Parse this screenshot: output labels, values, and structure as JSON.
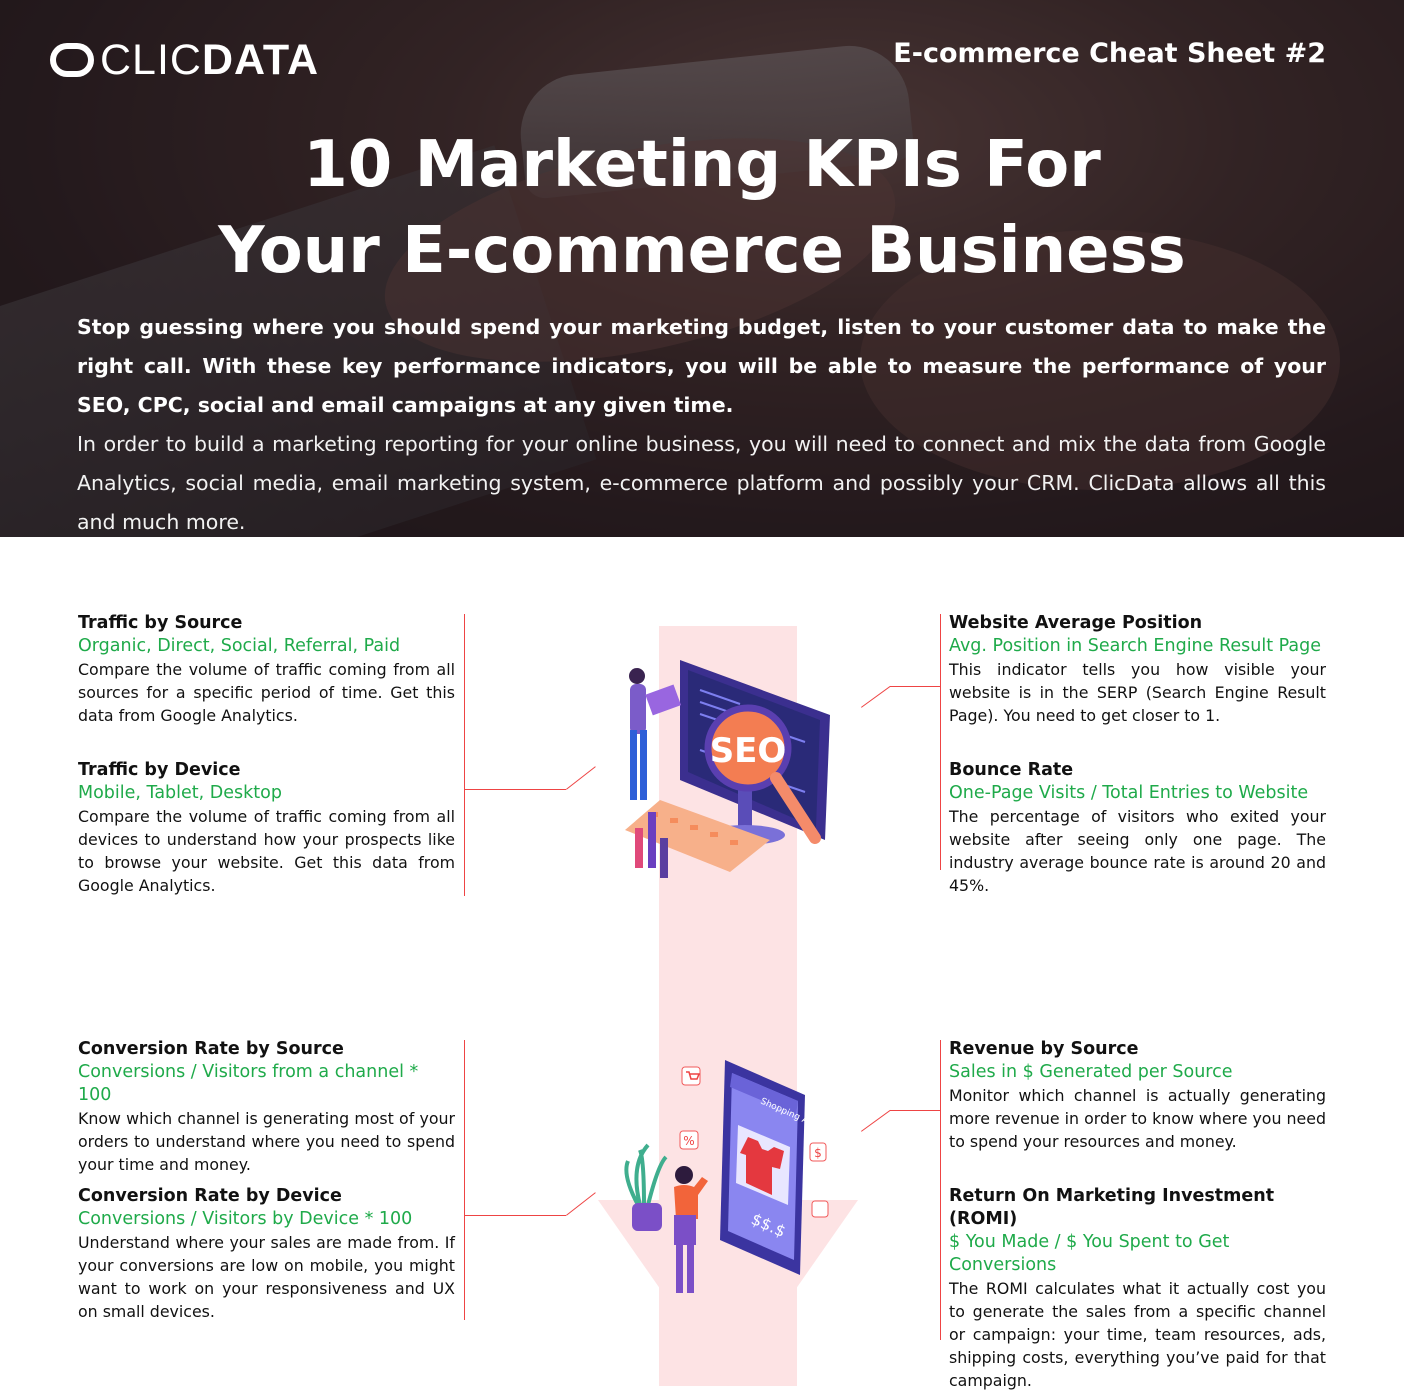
{
  "brand": {
    "logo_light": "CLIC",
    "logo_bold": "DATA"
  },
  "header": {
    "sheet_label": "E-commerce Cheat Sheet #2"
  },
  "title": {
    "line1": "10 Marketing KPIs For",
    "line2": "Your E-commerce Business"
  },
  "intro": {
    "bold_text": "Stop guessing where you should spend your marketing budget, listen to your customer data to make the right call. With these key performance indicators, you will be able to measure the performance of your SEO, CPC, social and email campaigns at any given time.",
    "normal_text": "In order to build a marketing reporting for your online business, you will need to connect and mix the data from Google Analytics, social media, email marketing system, e-commerce platform and possibly your CRM. ClicData allows all this and much more."
  },
  "kpis": [
    {
      "title": "Traffic by Source",
      "formula": "Organic, Direct, Social, Referral, Paid",
      "desc": "Compare the volume of traffic coming from all sources for a specific period of time. Get this data from Google Analytics."
    },
    {
      "title": "Traffic by Device",
      "formula": "Mobile, Tablet, Desktop",
      "desc": "Compare the volume of traffic coming from all devices to understand how your prospects like to browse your website. Get this data from Google Analytics."
    },
    {
      "title": "Website Average Position",
      "formula": "Avg. Position in Search Engine Result Page",
      "desc": "This indicator tells you how visible your website is in the SERP (Search Engine Result Page). You need to get closer to 1."
    },
    {
      "title": "Bounce Rate",
      "formula": "One-Page Visits / Total Entries to Website",
      "desc": "The percentage of visitors who exited your website after seeing only one page. The industry average bounce rate is around 20 and 45%."
    },
    {
      "title": "Conversion Rate by Source",
      "formula": "Conversions / Visitors from a channel * 100",
      "desc": "Know which channel is generating most of your orders to understand where you need to spend your time and money."
    },
    {
      "title": "Conversion Rate by Device",
      "formula": "Conversions / Visitors by Device * 100",
      "desc": "Understand where your sales are made from. If your conversions are low on mobile, you might want to work on your responsiveness and UX on small devices."
    },
    {
      "title": "Revenue by Source",
      "formula": "Sales in $ Generated per Source",
      "desc": "Monitor which channel is actually generating more revenue in order to know where you need to spend your resources and money."
    },
    {
      "title": "Return On Marketing Investment (ROMI)",
      "formula": "$ You Made / $ You Spent to Get Conversions",
      "desc": "The ROMI calculates what it actually cost you to generate the sales from a specific channel or campaign: your time, team resources, ads, shipping costs, everything you’ve paid for that campaign."
    }
  ],
  "illustrations": {
    "seo_label": "SEO",
    "shop_label": "Shopping App",
    "price_label": "$$.$",
    "percent_badge": "%",
    "dollar_badge": "$"
  },
  "colors": {
    "accent_green": "#1faa4a",
    "accent_red": "#e44444",
    "band_pink": "#fde3e4"
  }
}
